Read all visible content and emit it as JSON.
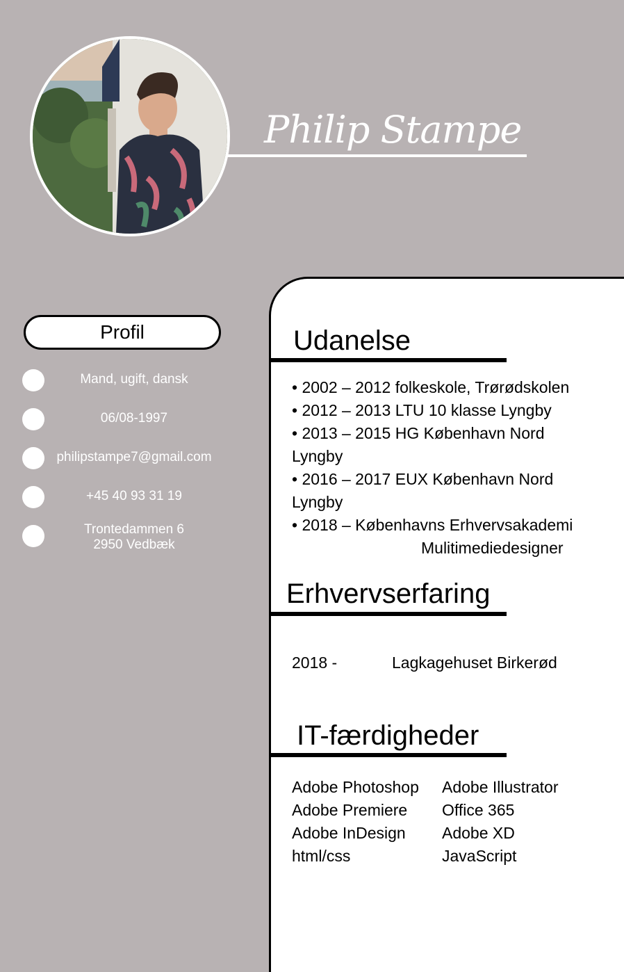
{
  "header": {
    "name": "Philip Stampe"
  },
  "profile": {
    "heading": "Profil",
    "items": [
      {
        "icon": "bullet-dot-icon",
        "text": "Mand, ugift, dansk"
      },
      {
        "icon": "bullet-dot-icon",
        "text": "06/08-1997"
      },
      {
        "icon": "bullet-dot-icon",
        "text": "philipstampe7@gmail.com"
      },
      {
        "icon": "bullet-dot-icon",
        "text": "+45 40 93 31 19"
      },
      {
        "icon": "bullet-dot-icon",
        "text": "Trontedammen 6",
        "text2": "2950 Vedbæk"
      }
    ]
  },
  "education": {
    "heading": "Udanelse",
    "lines": [
      "• 2002 – 2012 folkeskole, Trørødskolen",
      "• 2012 – 2013 LTU 10 klasse Lyngby",
      "• 2013 – 2015 HG København Nord",
      "Lyngby",
      "• 2016 – 2017 EUX København Nord",
      "Lyngby",
      "• 2018 –  Københavns Erhvervsakademi",
      "Mulitimediedesigner"
    ]
  },
  "experience": {
    "heading": "Erhvervserfaring",
    "year": "2018 -",
    "place": "Lagkagehuset Birkerød"
  },
  "skills": {
    "heading": "IT-færdigheder",
    "items": [
      "Adobe Photoshop",
      "Adobe Illustrator",
      "Adobe Premiere",
      "Office 365",
      "Adobe InDesign",
      "Adobe XD",
      "html/css",
      "JavaScript"
    ]
  },
  "colors": {
    "background": "#b8b2b3",
    "panel": "#ffffff",
    "accent": "#000000"
  }
}
